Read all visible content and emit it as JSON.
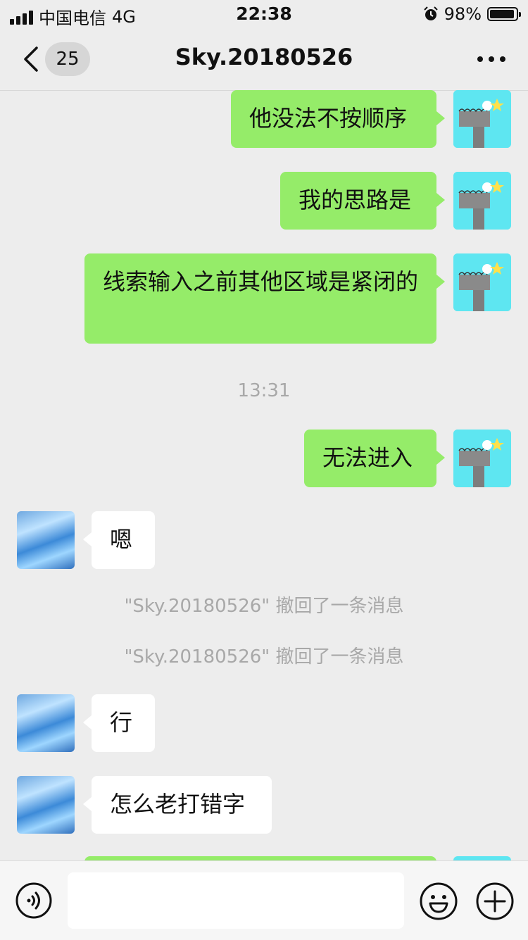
{
  "status_bar": {
    "carrier": "中国电信",
    "network": "4G",
    "time": "22:38",
    "battery": "98%"
  },
  "nav": {
    "badge": "25",
    "title": "Sky.20180526"
  },
  "messages": {
    "m1": "他没法不按顺序",
    "m2": "我的思路是",
    "m3": "线索输入之前其他区域是紧闭的",
    "time1": "13:31",
    "m4": "无法进入",
    "r1": "嗯",
    "sys1": "\"Sky.20180526\" 撤回了一条消息",
    "sys2": "\"Sky.20180526\" 撤回了一条消息",
    "r2": "行",
    "r3": "怎么老打错字"
  },
  "input_bar": {
    "placeholder": ""
  },
  "colors": {
    "my_bubble": "#95ec69",
    "other_bubble": "#ffffff",
    "background": "#ededed"
  },
  "icons": [
    "back-icon",
    "more-icon",
    "voice-icon",
    "emoji-icon",
    "plus-icon",
    "alarm-icon",
    "battery-icon",
    "signal-icon"
  ]
}
